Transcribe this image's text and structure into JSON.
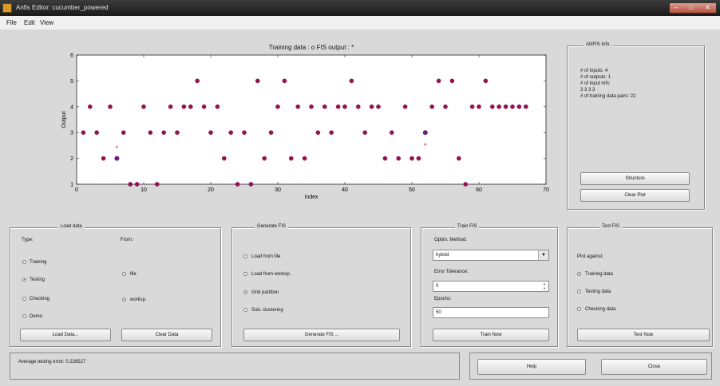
{
  "window": {
    "title": "Anfis Editor: cucumber_powered"
  },
  "menu": {
    "file": "File",
    "edit": "Edit",
    "view": "View"
  },
  "plot": {
    "title": "Training data : o   FIS output : *",
    "xlabel": "Index",
    "ylabel": "Output"
  },
  "chart_data": {
    "type": "scatter",
    "title": "Training data : o   FIS output : *",
    "xlabel": "Index",
    "ylabel": "Output",
    "xlim": [
      0,
      70
    ],
    "ylim": [
      1,
      6
    ],
    "xticks": [
      "0",
      "10",
      "20",
      "30",
      "40",
      "50",
      "60",
      "70"
    ],
    "yticks": [
      "1",
      "2",
      "3",
      "4",
      "5",
      "6"
    ],
    "grid": false,
    "series": [
      {
        "name": "Training data",
        "marker": "o",
        "color": "#9a1050",
        "x": [
          1,
          2,
          3,
          4,
          5,
          6,
          7,
          8,
          9,
          10,
          11,
          12,
          13,
          14,
          15,
          16,
          17,
          18,
          19,
          20,
          21,
          22,
          23,
          24,
          25,
          26,
          27,
          28,
          29,
          30,
          31,
          32,
          33,
          34,
          35,
          36,
          37,
          38,
          39,
          40,
          41,
          42,
          43,
          44,
          45,
          46,
          47,
          48,
          49,
          50,
          51,
          52,
          53,
          54,
          55,
          56,
          57,
          58,
          59,
          60,
          61,
          62,
          63,
          64,
          65,
          66,
          67
        ],
        "y": [
          3,
          4,
          3,
          2,
          4,
          2,
          3,
          1,
          1,
          4,
          3,
          1,
          3,
          4,
          3,
          4,
          4,
          5,
          4,
          3,
          4,
          2,
          3,
          1,
          3,
          1,
          5,
          2,
          3,
          4,
          5,
          2,
          4,
          2,
          4,
          3,
          4,
          3,
          4,
          4,
          5,
          4,
          3,
          4,
          4,
          2,
          3,
          2,
          4,
          2,
          2,
          3,
          4,
          5,
          4,
          5,
          2,
          1,
          4,
          4,
          5,
          4,
          4,
          4,
          4,
          4,
          4
        ]
      },
      {
        "name": "FIS output",
        "marker": "*",
        "color": "#c04040",
        "x": [
          6,
          52
        ],
        "y": [
          2.4,
          2.5
        ]
      }
    ],
    "hollow_points": {
      "x": [
        6,
        52
      ],
      "y": [
        2,
        3
      ],
      "color": "#3030c0"
    }
  },
  "anfis_info": {
    "legend": "ANFIS Info.",
    "lines": [
      "# of inputs: 4",
      "# of outputs: 1",
      "# of input mfs:",
      "3  3  3  3",
      "# of training data pairs: 22"
    ],
    "structure_button": "Structure",
    "clear_plot_button": "Clear Plot"
  },
  "load_data": {
    "legend": "Load data",
    "type_label": "Type:",
    "from_label": "From:",
    "types": [
      {
        "label": "Training",
        "selected": false
      },
      {
        "label": "Testing",
        "selected": true
      },
      {
        "label": "Checking",
        "selected": false
      },
      {
        "label": "Demo",
        "selected": false
      }
    ],
    "sources": [
      {
        "label": "file",
        "selected": false
      },
      {
        "label": "worksp.",
        "selected": true
      }
    ],
    "load_button": "Load Data...",
    "clear_button": "Clear Data"
  },
  "generate_fis": {
    "legend": "Generate FIS",
    "options": [
      {
        "label": "Load from file",
        "selected": false
      },
      {
        "label": "Load from worksp.",
        "selected": false
      },
      {
        "label": "Grid partition",
        "selected": true
      },
      {
        "label": "Sub. clustering",
        "selected": false
      }
    ],
    "button": "Generate FIS ..."
  },
  "train_fis": {
    "legend": "Train FIS",
    "optim_label": "Optim. Method:",
    "optim_value": "hybrid",
    "tolerance_label": "Error Tolerance:",
    "tolerance_value": "0",
    "epochs_label": "Epochs:",
    "epochs_value": "50",
    "button": "Train Now"
  },
  "test_fis": {
    "legend": "Test FIS",
    "plot_against": "Plot against:",
    "options": [
      {
        "label": "Training data",
        "selected": true
      },
      {
        "label": "Testing data",
        "selected": false
      },
      {
        "label": "Checking data",
        "selected": false
      }
    ],
    "button": "Test Now"
  },
  "status": {
    "text": "Average testing error: 0.226527"
  },
  "footer": {
    "help_button": "Help",
    "close_button": "Close"
  }
}
